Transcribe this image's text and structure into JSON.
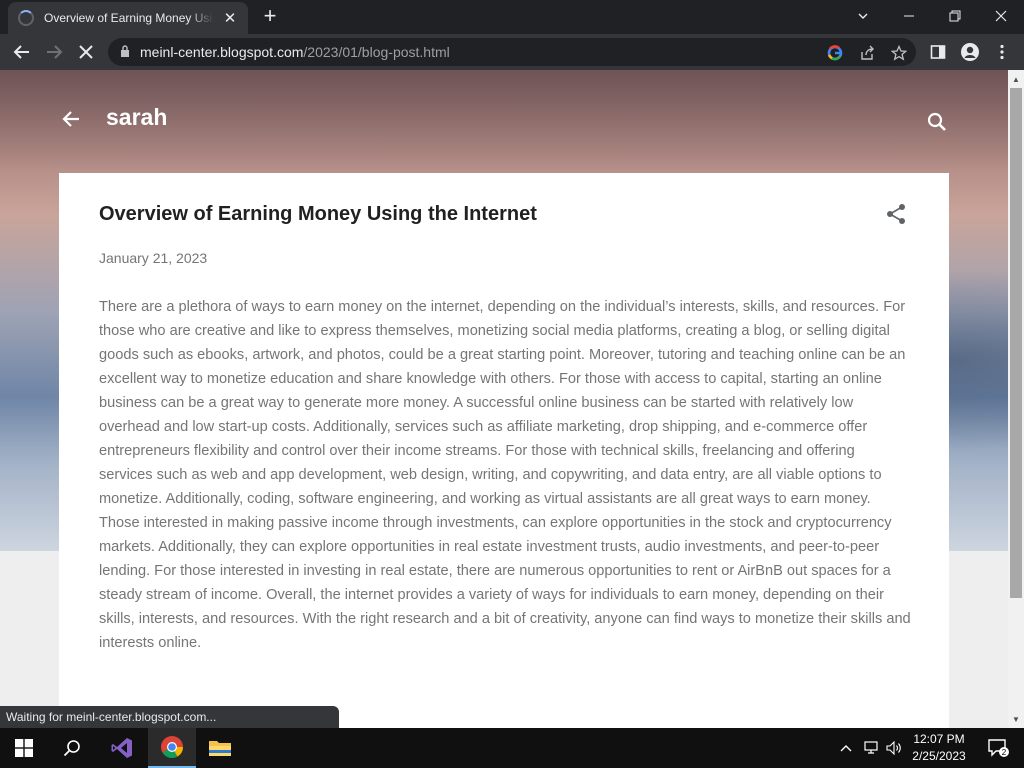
{
  "browser": {
    "tab_title": "Overview of Earning Money Using the Internet",
    "url_host": "meinl-center.blogspot.com",
    "url_path": "/2023/01/blog-post.html",
    "status_text": "Waiting for meinl-center.blogspot.com..."
  },
  "blog": {
    "name": "sarah"
  },
  "post": {
    "title": "Overview of Earning Money Using the Internet",
    "date": "January 21, 2023",
    "body": "There are a plethora of ways to earn money on the internet, depending on the individual’s interests, skills, and resources. For those who are creative and like to express themselves, monetizing social media platforms, creating a blog, or selling digital goods such as ebooks, artwork, and photos, could be a great starting point. Moreover, tutoring and teaching online can be an excellent way to monetize education and share knowledge with others. For those with access to capital, starting an online business can be a great way to generate more money. A successful online business can be started with relatively low overhead and low start-up costs. Additionally, services such as affiliate marketing, drop shipping, and e-commerce offer entrepreneurs flexibility and control over their income streams. For those with technical skills, freelancing and offering services such as web and app development, web design, writing, and copywriting, and data entry, are all viable options to monetize. Additionally, coding, software engineering, and working as virtual assistants are all great ways to earn money. Those interested in making passive income through investments, can explore opportunities in the stock and cryptocurrency markets. Additionally, they can explore opportunities in real estate investment trusts, audio investments, and peer-to-peer lending. For those interested in investing in real estate, there are numerous opportunities to rent or AirBnB out spaces for a steady stream of income. Overall, the internet provides a variety of ways for individuals to earn money, depending on their skills, interests, and resources. With the right research and a bit of creativity, anyone can find ways to monetize their skills and interests online."
  },
  "taskbar": {
    "time": "12:07 PM",
    "date": "2/25/2023",
    "notification_count": "2"
  },
  "colors": {
    "accent": "#8ab4f8",
    "title_text": "#212121",
    "body_text": "#757575"
  }
}
